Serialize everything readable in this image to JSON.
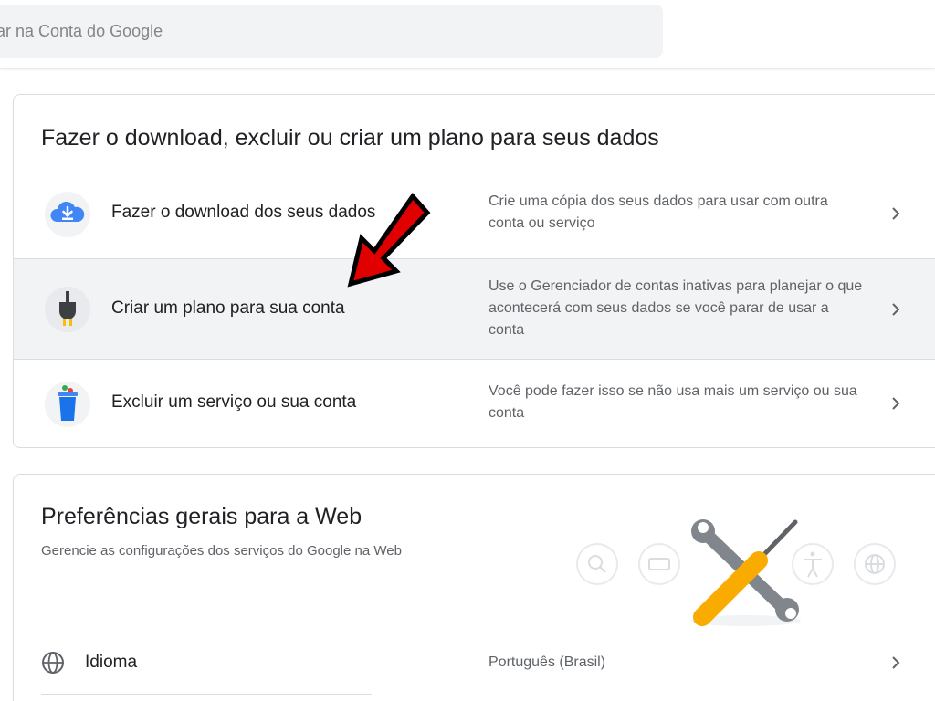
{
  "search": {
    "placeholder": "ar na Conta do Google"
  },
  "data_section": {
    "title": "Fazer o download, excluir ou criar um plano para seus dados",
    "items": [
      {
        "icon": "cloud-download-icon",
        "label": "Fazer o download dos seus dados",
        "description": "Crie uma cópia dos seus dados para usar com outra conta ou serviço"
      },
      {
        "icon": "plug-icon",
        "label": "Criar um plano para sua conta",
        "description": "Use o Gerenciador de contas inativas para planejar o que acontecerá com seus dados se você parar de usar a conta"
      },
      {
        "icon": "trash-bin-icon",
        "label": "Excluir um serviço ou sua conta",
        "description": "Você pode fazer isso se não usa mais um serviço ou sua conta"
      }
    ]
  },
  "web_prefs": {
    "title": "Preferências gerais para a Web",
    "subtitle": "Gerencie as configurações dos serviços do Google na Web",
    "illustration_icons": [
      "search-icon",
      "keyboard-icon",
      "accessibility-icon",
      "globe-icon",
      "wrench-screwdriver-icon"
    ],
    "language": {
      "label": "Idioma",
      "value": "Português (Brasil)"
    }
  },
  "colors": {
    "accent_red": "#e00000",
    "google_blue": "#1a73e8",
    "google_yellow": "#fbbc04"
  }
}
